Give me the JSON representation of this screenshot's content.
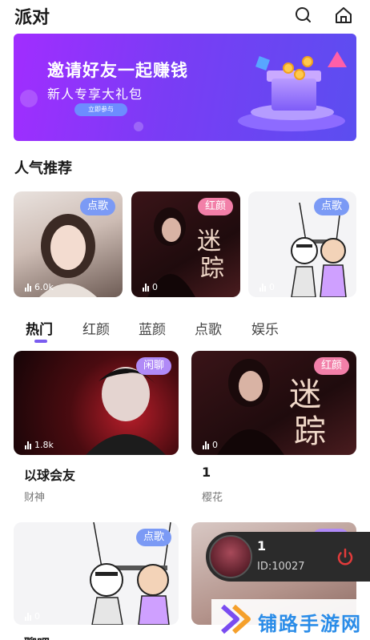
{
  "header": {
    "title": "派对",
    "icons": [
      "search-icon",
      "home-icon"
    ]
  },
  "banner": {
    "title": "邀请好友一起赚钱",
    "subtitle": "新人专享大礼包",
    "button_label": "立即参与"
  },
  "section": {
    "title": "人气推荐"
  },
  "recommended": [
    {
      "tag": "点歌",
      "tag_color": "#7b9af5",
      "count": "6.0k"
    },
    {
      "tag": "红颜",
      "tag_color": "#f27fa8",
      "count": "0"
    },
    {
      "tag": "点歌",
      "tag_color": "#7b9af5",
      "count": "0"
    }
  ],
  "tabs": [
    {
      "label": "热门",
      "active": true
    },
    {
      "label": "红颜",
      "active": false
    },
    {
      "label": "蓝颜",
      "active": false
    },
    {
      "label": "点歌",
      "active": false
    },
    {
      "label": "娱乐",
      "active": false
    }
  ],
  "rooms": [
    {
      "tag": "闲聊",
      "tag_color": "#b08af7",
      "count": "1.8k",
      "name": "以球会友",
      "host": "财神"
    },
    {
      "tag": "红颜",
      "tag_color": "#f27fa8",
      "count": "0",
      "name": "1",
      "host": "樱花"
    },
    {
      "tag": "点歌",
      "tag_color": "#7b9af5",
      "count": "0",
      "name": "聊吧",
      "host": ""
    },
    {
      "tag": "",
      "tag_color": "#b08af7",
      "count": "",
      "name": "",
      "host": ""
    }
  ],
  "mini_player": {
    "title": "1",
    "id_text": "ID:10027",
    "accent": "#e23b3b"
  },
  "watermark": {
    "text": "铺路手游网"
  },
  "colors": {
    "accent": "#7a5cf0",
    "banner_start": "#a12dff",
    "banner_end": "#5b4ef0"
  }
}
